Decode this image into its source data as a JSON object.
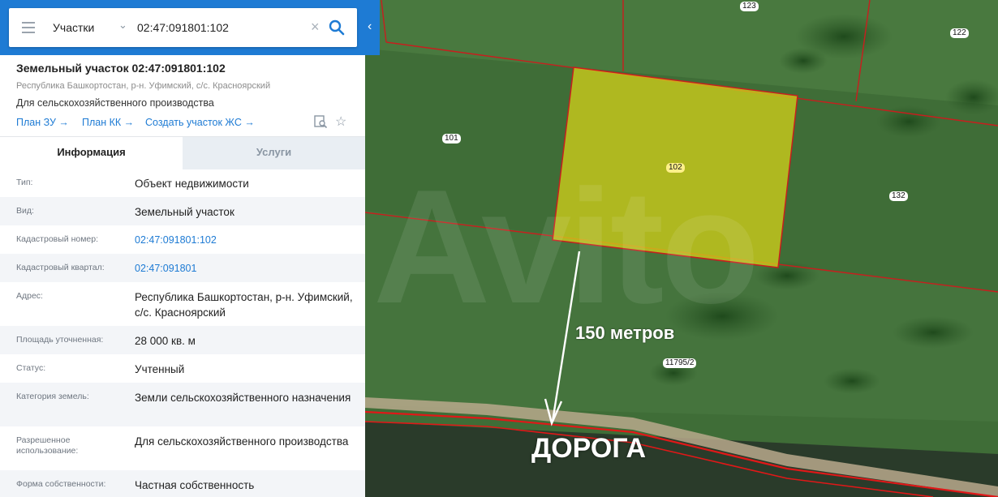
{
  "search": {
    "scope": "Участки",
    "query": "02:47:091801:102"
  },
  "object": {
    "title": "Земельный участок 02:47:091801:102",
    "subtitle": "Республика Башкортостан, р-н. Уфимский, с/с. Красноярский",
    "usage": "Для сельскохозяйственного производства",
    "links": [
      "План ЗУ →",
      "План КК →",
      "Создать участок ЖС →"
    ]
  },
  "tabs": {
    "info": "Информация",
    "services": "Услуги"
  },
  "rows": [
    {
      "label": "Тип:",
      "value": "Объект недвижимости"
    },
    {
      "label": "Вид:",
      "value": "Земельный участок"
    },
    {
      "label": "Кадастровый номер:",
      "value": "02:47:091801:102"
    },
    {
      "label": "Кадастровый квартал:",
      "value": "02:47:091801"
    },
    {
      "label": "Адрес:",
      "value": "Республика Башкортостан, р-н. Уфимский, с/с. Красноярский"
    },
    {
      "label": "Площадь уточненная:",
      "value": "28 000 кв. м"
    },
    {
      "label": "Статус:",
      "value": "Учтенный"
    },
    {
      "label": "Категория земель:",
      "value": "Земли сельскохозяйственного назначения"
    },
    {
      "label": "Разрешенное использование:",
      "value": "Для сельскохозяйственного производства"
    },
    {
      "label": "Форма собственности:",
      "value": "Частная собственность"
    }
  ],
  "map": {
    "parcel_labels": [
      "123",
      "122",
      "101",
      "102",
      "132",
      "11795/2"
    ],
    "annotation_distance": "150 метров",
    "annotation_road": "ДОРОГА",
    "watermark": "Avito",
    "colors": {
      "selected_parcel": "#d6d21a",
      "boundary": "#c81e1e",
      "road_boundary": "#e01818",
      "accent": "#1e7bd4"
    }
  }
}
